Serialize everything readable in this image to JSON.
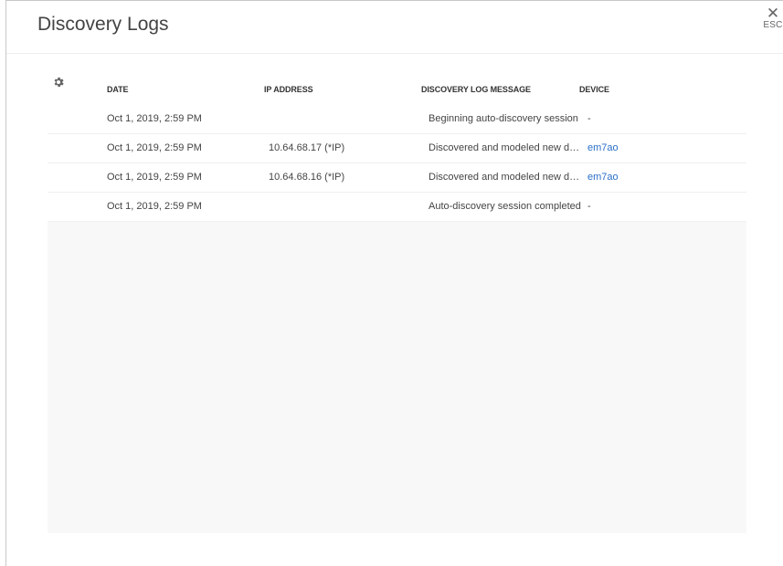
{
  "modal": {
    "title": "Discovery Logs",
    "close_label": "ESC"
  },
  "columns": {
    "date": "DATE",
    "ip": "IP ADDRESS",
    "message": "DISCOVERY LOG MESSAGE",
    "device": "DEVICE"
  },
  "rows": [
    {
      "date": "Oct 1, 2019, 2:59 PM",
      "ip": "",
      "message": "Beginning auto-discovery session",
      "device": "-"
    },
    {
      "date": "Oct 1, 2019, 2:59 PM",
      "ip": "10.64.68.17 (*IP)",
      "message": "Discovered and modeled new device",
      "device": "em7ao"
    },
    {
      "date": "Oct 1, 2019, 2:59 PM",
      "ip": "10.64.68.16 (*IP)",
      "message": "Discovered and modeled new device",
      "device": "em7ao"
    },
    {
      "date": "Oct 1, 2019, 2:59 PM",
      "ip": "",
      "message": "Auto-discovery session completed",
      "device": "-"
    }
  ],
  "colors": {
    "link": "#2a6fc9",
    "grid_background": "#f8f8f8"
  },
  "icons": {
    "settings": "gear-icon",
    "close": "close-icon"
  }
}
